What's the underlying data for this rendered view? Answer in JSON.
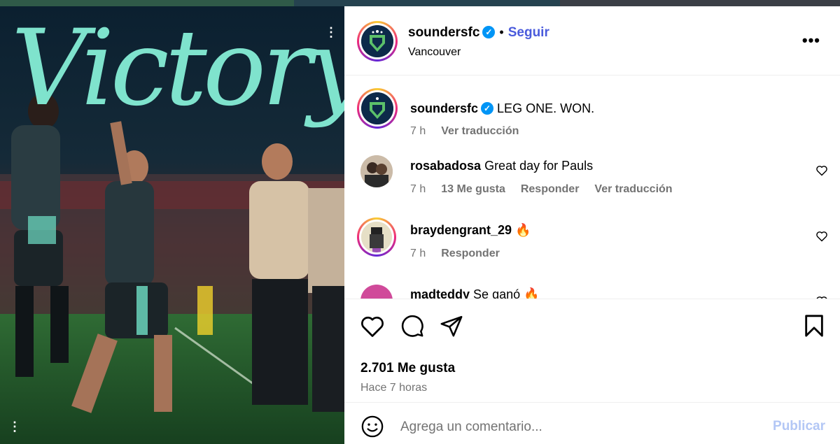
{
  "post": {
    "image_title": "Victory",
    "author": "soundersfc",
    "follow_label": "Seguir",
    "separator": "•",
    "location": "Vancouver",
    "caption_user": "soundersfc",
    "caption_text": "LEG ONE. WON.",
    "caption_time": "7 h",
    "caption_translate": "Ver traducción"
  },
  "comments": [
    {
      "user": "rosabadosa",
      "text": "Great day for Pauls",
      "time": "7 h",
      "likes": "13 Me gusta",
      "reply": "Responder",
      "translate": "Ver traducción"
    },
    {
      "user": "braydengrant_29",
      "text": "🔥",
      "time": "7 h",
      "reply": "Responder"
    },
    {
      "user": "madteddy",
      "text": "Se ganó 🔥"
    }
  ],
  "actions": {
    "likes_count": "2.701 Me gusta",
    "posted_ago": "Hace 7 horas"
  },
  "composer": {
    "placeholder": "Agrega un comentario...",
    "publish_label": "Publicar"
  },
  "colors": {
    "accent": "#4a5bdc",
    "verified": "#0095f6",
    "muted_text": "#737373",
    "publish_disabled": "#b3c7f5",
    "image_title": "#7fe3cd"
  },
  "icons": [
    "more-options-icon",
    "like-icon",
    "comment-icon",
    "share-icon",
    "save-icon",
    "emoji-icon",
    "verified-badge-icon"
  ]
}
